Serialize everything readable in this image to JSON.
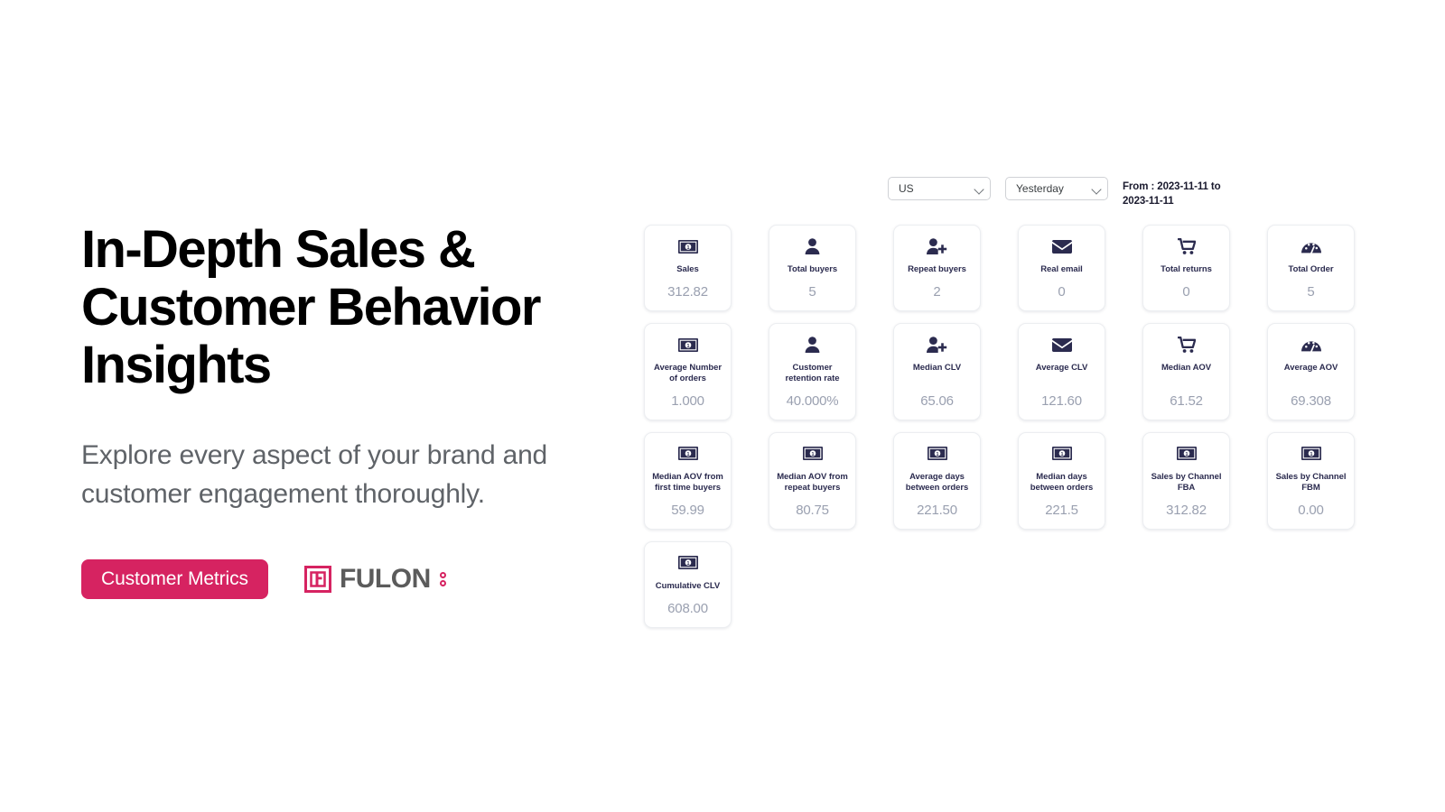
{
  "hero": {
    "title": "In-Depth Sales &\nCustomer Behavior\nInsights",
    "subtitle": "Explore every aspect of your brand and\ncustomer engagement thoroughly.",
    "cta_label": "Customer Metrics",
    "logo_word": "FULON",
    "logo_mark_icon": "fulon-square-mark-icon"
  },
  "filters": {
    "country": {
      "value": "US",
      "icon": "chevron-down-icon"
    },
    "period": {
      "value": "Yesterday",
      "icon": "chevron-down-icon"
    },
    "date_range": "From : 2023-11-11 to 2023-11-11"
  },
  "colors": {
    "accent_pink": "#d62361",
    "icon_navy": "#2b2b4f",
    "label_navy": "#2b2b4f",
    "value_gray": "#9aa0b0",
    "subtitle_gray": "#5f6368",
    "title_black": "#000000",
    "card_border": "#eceef1"
  },
  "metrics": [
    {
      "label": "Sales",
      "value": "312.82",
      "icon": "banknote-icon"
    },
    {
      "label": "Total buyers",
      "value": "5",
      "icon": "user-icon"
    },
    {
      "label": "Repeat buyers",
      "value": "2",
      "icon": "user-plus-icon"
    },
    {
      "label": "Real email",
      "value": "0",
      "icon": "envelope-icon"
    },
    {
      "label": "Total returns",
      "value": "0",
      "icon": "shopping-cart-icon"
    },
    {
      "label": "Total Order",
      "value": "5",
      "icon": "gauge-icon"
    },
    {
      "label": "Average Number\nof orders",
      "value": "1.000",
      "icon": "banknote-icon"
    },
    {
      "label": "Customer\nretention rate",
      "value": "40.000%",
      "icon": "user-icon"
    },
    {
      "label": "Median CLV",
      "value": "65.06",
      "icon": "user-plus-icon"
    },
    {
      "label": "Average CLV",
      "value": "121.60",
      "icon": "envelope-icon"
    },
    {
      "label": "Median AOV",
      "value": "61.52",
      "icon": "shopping-cart-icon"
    },
    {
      "label": "Average AOV",
      "value": "69.308",
      "icon": "gauge-icon"
    },
    {
      "label": "Median AOV from\nfirst time buyers",
      "value": "59.99",
      "icon": "banknote-icon"
    },
    {
      "label": "Median AOV from\nrepeat buyers",
      "value": "80.75",
      "icon": "banknote-icon"
    },
    {
      "label": "Average days\nbetween orders",
      "value": "221.50",
      "icon": "banknote-icon"
    },
    {
      "label": "Median days\nbetween orders",
      "value": "221.5",
      "icon": "banknote-icon"
    },
    {
      "label": "Sales by Channel\nFBA",
      "value": "312.82",
      "icon": "banknote-icon"
    },
    {
      "label": "Sales by Channel\nFBM",
      "value": "0.00",
      "icon": "banknote-icon"
    },
    {
      "label": "Cumulative CLV",
      "value": "608.00",
      "icon": "banknote-icon"
    }
  ]
}
